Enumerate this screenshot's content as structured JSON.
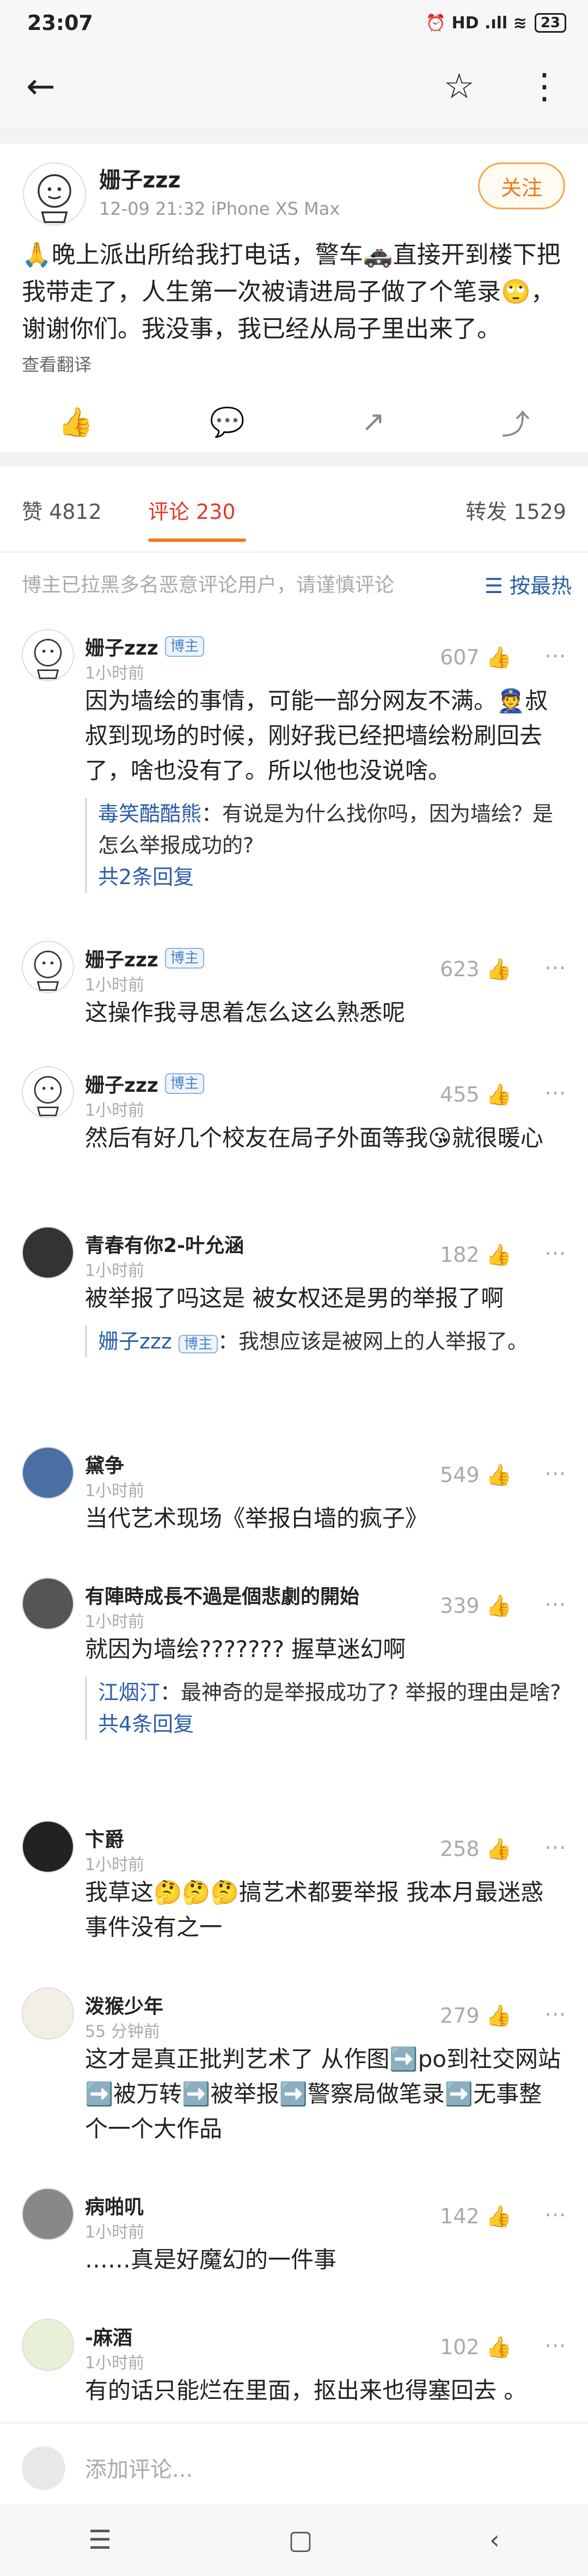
{
  "status": {
    "time": "23:07",
    "icons": "⏰ HD .ıll ≋",
    "battery": "23"
  },
  "nav": {
    "back": "←",
    "star": "☆",
    "more": "⋮"
  },
  "post": {
    "author": "姗子zzz",
    "meta": "12-09 21:32  iPhone XS Max",
    "follow": "关注",
    "text": "🙏晚上派出所给我打电话，警车🚓直接开到楼下把我带走了，人生第一次被请进局子做了个笔录🙄，谢谢你们。我没事，我已经从局子里出来了。",
    "translate": "查看翻译"
  },
  "counts": {
    "likes": "赞  4812",
    "comments": "评论  230",
    "reposts": "转发  1529"
  },
  "notice": {
    "text": "博主已拉黑多名恶意评论用户，请谨慎评论",
    "sort": "☰ 按最热"
  },
  "comments": [
    {
      "name": "姗子zzz",
      "badge": "博主",
      "time": "1小时前",
      "likes": "607 👍",
      "text": "因为墙绘的事情，可能一部分网友不满。👮叔叔到现场的时候，刚好我已经把墙绘粉刷回去了，啥也没有了。所以他也没说啥。",
      "reply_name": "毒笑酷酷熊",
      "reply_text": "：有说是为什么找你吗，因为墙绘？是怎么举报成功的?",
      "reply_more": "共2条回复"
    },
    {
      "name": "姗子zzz",
      "badge": "博主",
      "time": "1小时前",
      "likes": "623 👍",
      "text": "这操作我寻思着怎么这么熟悉呢"
    },
    {
      "name": "姗子zzz",
      "badge": "博主",
      "time": "1小时前",
      "likes": "455 👍",
      "text": "然后有好几个校友在局子外面等我😘就很暖心"
    },
    {
      "name": "青春有你2-叶允涵",
      "time": "1小时前",
      "likes": "182 👍",
      "text": "被举报了吗这是 被女权还是男的举报了啊",
      "reply_name": "姗子zzz",
      "reply_badge": "博主",
      "reply_text": "：我想应该是被网上的人举报了。"
    },
    {
      "name": "黛争",
      "time": "1小时前",
      "likes": "549 👍",
      "text": "当代艺术现场《举报白墙的疯子》"
    },
    {
      "name": "有陣時成長不過是個悲劇的開始",
      "time": "1小时前",
      "likes": "339 👍",
      "text": "就因为墙绘??????? 握草迷幻啊",
      "reply_name": "江烟汀",
      "reply_text": "：最神奇的是举报成功了? 举报的理由是啥?",
      "reply_more": "共4条回复"
    },
    {
      "name": "卞爵",
      "time": "1小时前",
      "likes": "258 👍",
      "text": "我草这🤔🤔🤔搞艺术都要举报 我本月最迷惑事件没有之一"
    },
    {
      "name": "泼猴少年",
      "time": "55 分钟前",
      "likes": "279 👍",
      "text": "这才是真正批判艺术了 从作图➡️po到社交网站➡️被万转➡️被举报➡️警察局做笔录➡️无事整个一个大作品"
    },
    {
      "name": "病啪叽",
      "time": "1小时前",
      "likes": "142 👍",
      "text": "……真是好魔幻的一件事"
    },
    {
      "name": "-麻酒",
      "time": "1小时前",
      "likes": "102 👍",
      "text": "有的话只能烂在里面，抠出来也得塞回去 。"
    }
  ],
  "input": {
    "placeholder": "添加评论..."
  },
  "sysnav": {
    "menu": "☰",
    "home": "▢",
    "back": "‹"
  },
  "actions": {
    "like": "👍",
    "comment": "💬",
    "repost": "↗",
    "share": "⤴"
  },
  "share_icon": "⋯"
}
